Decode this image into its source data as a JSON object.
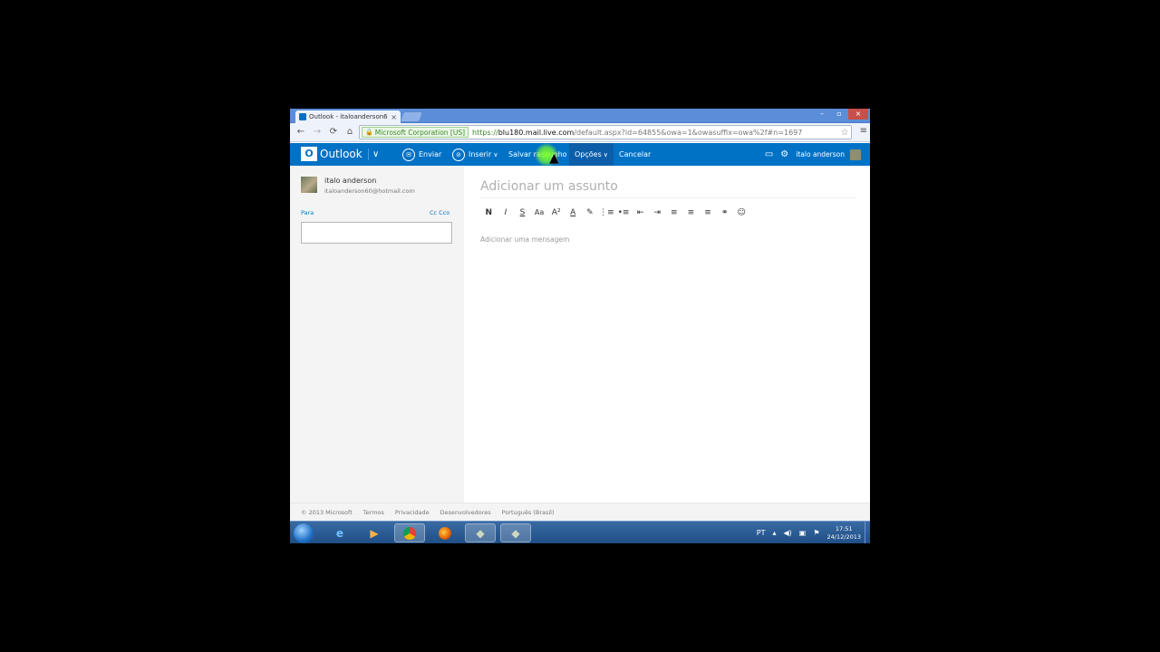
{
  "browser": {
    "tab_title": "Outlook - italoanderson6",
    "tab_close": "×",
    "window_controls": [
      "–",
      "▫",
      "×"
    ],
    "nav": {
      "back": "←",
      "forward": "→",
      "reload": "⟳",
      "home": "⌂"
    },
    "ev_badge": "Microsoft Corporation [US]",
    "url_scheme": "https://",
    "url_host": "blu180.mail.live.com",
    "url_rest": "/default.aspx?id=64855&owa=1&owasuffix=owa%2f#n=1697",
    "star": "☆",
    "menu": "≡"
  },
  "outlook": {
    "logo_mark": "O",
    "logo_text": "Outlook",
    "switch": "∨",
    "commands": {
      "send": "Enviar",
      "insert": "Inserir",
      "save_draft": "Salvar rascunho",
      "options": "Opções",
      "cancel": "Cancelar"
    },
    "user_name": "italo anderson"
  },
  "compose": {
    "from_name": "italo anderson",
    "from_email": "italoanderson60@hotmail.com",
    "to_label": "Para",
    "cc_bcc": "Cc Cco",
    "subject_placeholder": "Adicionar um assunto",
    "body_placeholder": "Adicionar uma mensagem",
    "format_tools": [
      "N",
      "I",
      "S",
      "Aa",
      "A²",
      "A",
      "✎",
      "⋮≡",
      "•≡",
      "⇤",
      "⇥",
      "≡",
      "≡",
      "≡",
      "⚭",
      "☺"
    ]
  },
  "footer": {
    "copyright": "© 2013 Microsoft",
    "terms": "Termos",
    "privacy": "Privacidade",
    "developers": "Desenvolvedores",
    "language": "Português (Brasil)"
  },
  "taskbar": {
    "language": "PT",
    "time": "17:51",
    "date": "24/12/2013"
  }
}
